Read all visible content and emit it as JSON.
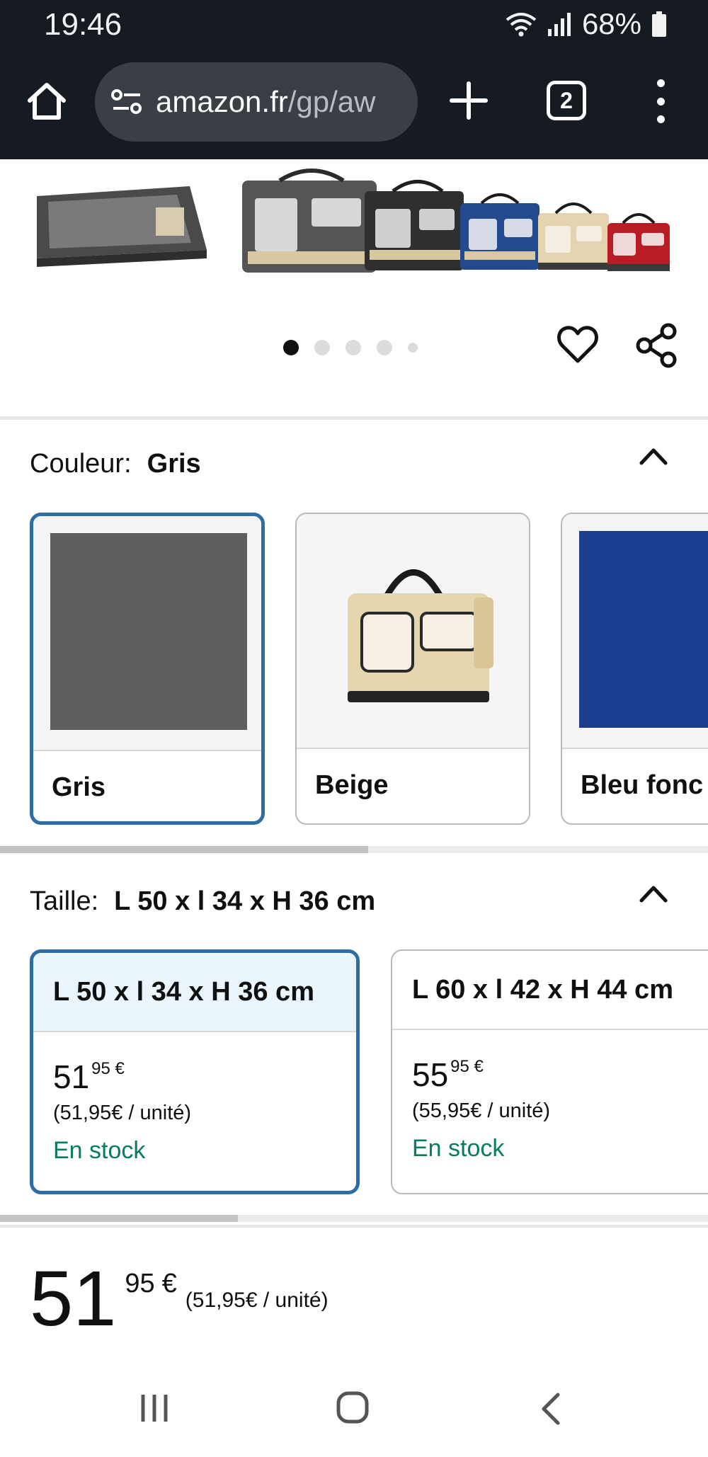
{
  "status_bar": {
    "time": "19:46",
    "battery": "68%"
  },
  "browser": {
    "url_host": "amazon.fr",
    "url_path": "/gp/aw",
    "tab_count": "2"
  },
  "carousel": {
    "dot_count": 5,
    "active_index": 0
  },
  "color_section": {
    "label": "Couleur:",
    "selected_value": "Gris",
    "swatches": [
      {
        "name": "Gris",
        "color": "#5f5f5f",
        "selected": true
      },
      {
        "name": "Beige",
        "color": "#e7d9b8",
        "selected": false
      },
      {
        "name": "Bleu fonc",
        "color": "#1a3d8f",
        "selected": false
      }
    ]
  },
  "size_section": {
    "label": "Taille:",
    "selected_value": "L 50 x l 34 x H 36 cm",
    "options": [
      {
        "title": "L 50 x l 34 x H 36 cm",
        "price_whole": "51",
        "price_fraction": "95",
        "currency": "€",
        "unit_price": "(51,95€ / unité)",
        "stock": "En stock",
        "selected": true
      },
      {
        "title": "L 60 x l 42 x H 44 cm",
        "price_whole": "55",
        "price_fraction": "95",
        "currency": "€",
        "unit_price": "(55,95€ / unité)",
        "stock": "En stock",
        "selected": false
      }
    ]
  },
  "price_block": {
    "whole": "51",
    "fraction": "95",
    "currency": "€",
    "unit_price": "(51,95€ / unité)"
  },
  "colors": {
    "accent_selected": "#2e6da4",
    "stock_green": "#067d62",
    "browser_bar": "#161b22"
  }
}
